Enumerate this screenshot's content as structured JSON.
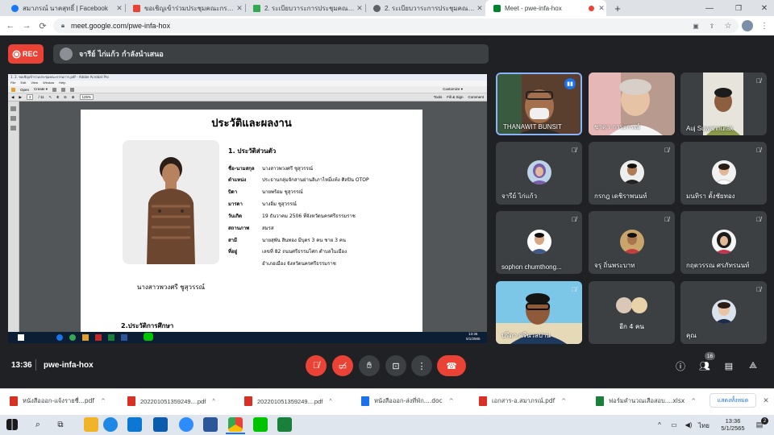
{
  "tabs": [
    {
      "title": "สมาภรณ์ นาคสุทธิ์ | Facebook",
      "color": "#1877f2"
    },
    {
      "title": "ขอเชิญเข้าร่วมประชุมคณะกรรมการ",
      "color": "#ea4335"
    },
    {
      "title": "2. ระเบียบวาระการประชุมคณะกรรมการ",
      "color": "#34a853"
    },
    {
      "title": "2. ระเบียบวาระการประชุมคณะกรรมการ",
      "color": "#5f6368"
    },
    {
      "title": "Meet - pwe-infa-hox",
      "color": "#00832d"
    }
  ],
  "new_tab": "+",
  "address": {
    "url": "meet.google.com/pwe-infa-hox"
  },
  "rec_label": "REC",
  "presenter_banner": "จารีย์ ไก่แก้ว กำลังนำเสนอ",
  "acrobat": {
    "title": "1. 2. ขอเชิญเข้าร่วมประชุมคณะกรรมการ.pdf - Adobe Acrobat Pro",
    "menu": [
      "File",
      "Edit",
      "View",
      "Window",
      "Help"
    ],
    "open": "Open",
    "create": "Create ▾",
    "page_current": "2",
    "page_total": "/ 11",
    "zoom": "125%",
    "customize": "Customize ▾",
    "tools": "Tools",
    "fill_sign": "Fill & Sign",
    "comment": "Comment",
    "clock_time": "13:36",
    "clock_date": "5/1/2565"
  },
  "doc": {
    "title": "ประวัติและผลงาน",
    "photo_caption": "นางสาวพวงศรี ชูสุวรรณ์",
    "section1": "1. ประวัติส่วนตัว",
    "fields": [
      {
        "k": "ชื่อ-นามสกุล",
        "v": "นางสาวพวงศรี ชูสุวรรณ์"
      },
      {
        "k": "ตำแหน่ง",
        "v": "ประธานกลุ่มจักสานย่านลิเภาไหมี่แท้ง ศิลปิน OTOP"
      },
      {
        "k": "บิดา",
        "v": "นายพร้อม ชูสุวรรณ์"
      },
      {
        "k": "มารดา",
        "v": "นางอิ่ม ชูสุวรรณ์"
      },
      {
        "k": "วันเกิด",
        "v": "19 ธันวาคม 2506 ที่จังหวัดนครศรีธรรมราช"
      },
      {
        "k": "สถานภาพ",
        "v": "สมรส"
      },
      {
        "k": "สามี",
        "v": "นายสุพัน สินทอง  มีบุตร 3 คน ชาย 3 คน"
      },
      {
        "k": "ที่อยู่",
        "v": "เลขที่ 82 ถนนศรีธรรมโศก ตำบลในเมือง"
      },
      {
        "k": "",
        "v": "อำเภอเมือง จังหวัดนครศรีธรรมราช"
      }
    ],
    "section2": "2.ประวัติการศึกษา"
  },
  "participants": [
    {
      "name": "THANAWIT BUNSIT",
      "muted": false,
      "speaking": true
    },
    {
      "name": "ชาดา การะกรณ์",
      "muted": false
    },
    {
      "name": "Auj Suwannurak",
      "muted": true
    },
    {
      "name": "จารีย์ ไก่แก้ว",
      "muted": true
    },
    {
      "name": "กรกฎ เดชิราพนนท์",
      "muted": true
    },
    {
      "name": "มนทิรา ตั้งชัยทอง",
      "muted": true
    },
    {
      "name": "sophon chumthong...",
      "muted": true
    },
    {
      "name": "จรุ ถิ่นพระบาท",
      "muted": true
    },
    {
      "name": "กฤตวรรณ ศรภัทรนนท์",
      "muted": true
    },
    {
      "name": "ปรีดา ศรีนวลปาน",
      "muted": true
    },
    {
      "name": "อีก 4 คน",
      "muted": false
    },
    {
      "name": "คุณ",
      "muted": true
    }
  ],
  "meeting": {
    "time": "13:36",
    "code": "pwe-infa-hox",
    "participants_count": "16"
  },
  "downloads": [
    {
      "name": "หนังสือออก-แจ้งรายชื่...pdf",
      "color": "#d93025"
    },
    {
      "name": "202201051359249....pdf",
      "color": "#d93025"
    },
    {
      "name": "202201051359249....pdf",
      "color": "#d93025"
    },
    {
      "name": "หนังสือออก-ส่งที่พัก....doc",
      "color": "#1a73e8"
    },
    {
      "name": "เอกสาร-อ.สมาภรณ์.pdf",
      "color": "#d93025"
    },
    {
      "name": "ฟอร์มคำนวณเสือสอบ....xlsx",
      "color": "#188038"
    }
  ],
  "show_all": "แสดงทั้งหมด",
  "taskbar": {
    "lang": "ไทย",
    "time": "13:36",
    "date": "5/1/2565",
    "badge": "2"
  },
  "colors": {
    "meet_bg": "#202124",
    "tile_bg": "#3c4043",
    "danger": "#ea4335",
    "link": "#1a73e8"
  }
}
